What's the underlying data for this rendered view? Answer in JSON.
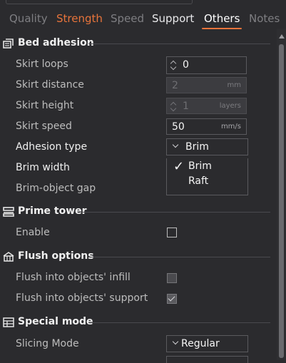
{
  "tabs": {
    "quality": "Quality",
    "strength": "Strength",
    "speed": "Speed",
    "support": "Support",
    "others": "Others",
    "notes": "Notes"
  },
  "sections": {
    "bed_adhesion": "Bed adhesion",
    "prime_tower": "Prime tower",
    "flush_options": "Flush options",
    "special_mode": "Special mode"
  },
  "bed_adhesion": {
    "skirt_loops": {
      "label": "Skirt loops",
      "value": "0"
    },
    "skirt_distance": {
      "label": "Skirt distance",
      "value": "2",
      "unit": "mm"
    },
    "skirt_height": {
      "label": "Skirt height",
      "value": "1",
      "unit": "layers"
    },
    "skirt_speed": {
      "label": "Skirt speed",
      "value": "50",
      "unit": "mm/s"
    },
    "adhesion_type": {
      "label": "Adhesion type",
      "value": "Brim",
      "options": [
        "Brim",
        "Raft"
      ],
      "selected": "Brim"
    },
    "brim_width": {
      "label": "Brim width"
    },
    "brim_object_gap": {
      "label": "Brim-object gap"
    }
  },
  "prime_tower": {
    "enable": {
      "label": "Enable",
      "checked": false
    }
  },
  "flush_options": {
    "flush_infill": {
      "label": "Flush into objects' infill",
      "checked": false
    },
    "flush_support": {
      "label": "Flush into objects' support",
      "checked": true
    }
  },
  "special_mode": {
    "slicing_mode": {
      "label": "Slicing Mode",
      "value": "Regular"
    }
  },
  "colors": {
    "accent": "#e8743b",
    "background": "#2b2b2e"
  },
  "icons": {
    "bed_adhesion": "bed-adhesion-icon",
    "prime_tower": "prime-tower-icon",
    "flush_options": "flush-options-icon",
    "special_mode": "special-mode-icon"
  }
}
